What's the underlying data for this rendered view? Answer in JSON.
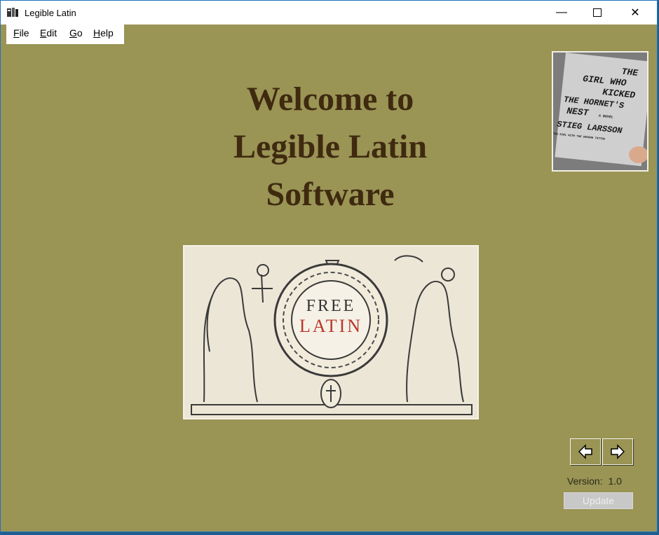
{
  "window": {
    "title": "Legible Latin",
    "minimize_glyph": "—",
    "maximize_glyph": "☐",
    "close_glyph": "✕"
  },
  "menu": {
    "items": [
      {
        "label": "File",
        "accel": "F",
        "rest": "ile"
      },
      {
        "label": "Edit",
        "accel": "E",
        "rest": "dit"
      },
      {
        "label": "Go",
        "accel": "G",
        "rest": "o"
      },
      {
        "label": "Help",
        "accel": "H",
        "rest": "elp"
      }
    ]
  },
  "welcome": {
    "line1": "Welcome to",
    "line2": "Legible Latin",
    "line3": "Software"
  },
  "book_cover": {
    "title_lines": [
      "THE",
      "GIRL WHO",
      "KICKED",
      "THE HORNET'S",
      "NEST"
    ],
    "tag": "A NOVEL",
    "author": "STIEG LARSSON",
    "subline": "THE GIRL WITH THE DRAGON TATTOO"
  },
  "emblem": {
    "line1": "FREE",
    "line2": "LATIN"
  },
  "navigation": {
    "back_icon": "left-arrow-icon",
    "forward_icon": "right-arrow-icon"
  },
  "footer": {
    "version_label": "Version:",
    "version_value": "1.0",
    "update_label": "Update"
  },
  "colors": {
    "background": "#9a9455",
    "welcome_text": "#3f2a10",
    "latin_red": "#b8382e"
  }
}
